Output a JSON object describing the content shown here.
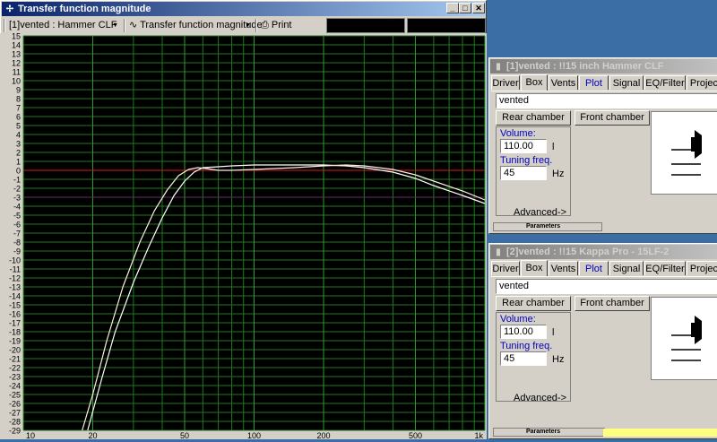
{
  "main_window": {
    "title": "Transfer function magnitude",
    "toolbar": {
      "driver_select": "[1]vented : Hammer CLF",
      "plot_select": "Transfer function magnitude",
      "print_label": "Print"
    }
  },
  "chart_data": {
    "type": "line",
    "xscale": "log",
    "xlim": [
      10,
      1000
    ],
    "ylim": [
      -29,
      15
    ],
    "x_ticks": [
      "10",
      "20",
      "50",
      "100",
      "200",
      "500",
      "1k"
    ],
    "y_ticks": [
      "15",
      "14",
      "13",
      "12",
      "11",
      "10",
      "9",
      "8",
      "7",
      "6",
      "5",
      "4",
      "3",
      "2",
      "1",
      "0",
      "-1",
      "-2",
      "-3",
      "-4",
      "-5",
      "-6",
      "-7",
      "-8",
      "-9",
      "-10",
      "-11",
      "-12",
      "-13",
      "-14",
      "-15",
      "-16",
      "-17",
      "-18",
      "-19",
      "-20",
      "-21",
      "-22",
      "-23",
      "-24",
      "-25",
      "-26",
      "-27",
      "-28",
      "-29"
    ],
    "grid": true,
    "reference_line": 0,
    "series": [
      {
        "color": "#ffffff",
        "x": [
          19,
          22,
          25,
          30,
          35,
          40,
          45,
          50,
          55,
          60,
          70,
          80,
          100,
          150,
          200,
          250,
          300,
          400,
          500,
          600,
          800,
          1000
        ],
        "y": [
          -29,
          -23,
          -18,
          -12.5,
          -8.5,
          -5.3,
          -2.8,
          -1.2,
          -0.2,
          0.3,
          0.4,
          0.5,
          0.6,
          0.6,
          0.6,
          0.5,
          0.3,
          -0.2,
          -0.9,
          -1.7,
          -2.8,
          -3.7
        ]
      },
      {
        "color": "#ffeedd",
        "x": [
          18,
          20,
          23,
          27,
          32,
          37,
          42,
          47,
          52,
          57,
          62,
          70,
          80,
          100,
          150,
          200,
          250,
          300,
          400,
          500,
          600,
          800,
          1000
        ],
        "y": [
          -29,
          -25,
          -19,
          -13,
          -8,
          -4.5,
          -2.2,
          -0.6,
          0.1,
          0.3,
          0.2,
          0.0,
          0.0,
          0.1,
          0.3,
          0.5,
          0.6,
          0.5,
          0.1,
          -0.5,
          -1.2,
          -2.3,
          -3.3
        ]
      }
    ]
  },
  "panels": [
    {
      "title": "[1]vented : !!15 inch Hammer CLF",
      "tabs": [
        "Driver",
        "Box",
        "Vents",
        "Plot",
        "Signal",
        "EQ/Filter",
        "Project"
      ],
      "selected_tab": "Box",
      "box_type": "vented",
      "rear_chamber": "Rear chamber",
      "front_chamber": "Front chamber",
      "volume_label": "Volume:",
      "volume_value": "110.00",
      "volume_unit": "l",
      "tuning_label": "Tuning freq.",
      "tuning_value": "45",
      "tuning_unit": "Hz",
      "advanced_label": "Advanced->",
      "status": "Parameters"
    },
    {
      "title": "[2]vented : !!15 Kappa Pro - 15LF-2",
      "tabs": [
        "Driver",
        "Box",
        "Vents",
        "Plot",
        "Signal",
        "EQ/Filter",
        "Project"
      ],
      "selected_tab": "Box",
      "box_type": "vented",
      "rear_chamber": "Rear chamber",
      "front_chamber": "Front chamber",
      "volume_label": "Volume:",
      "volume_value": "110.00",
      "volume_unit": "l",
      "tuning_label": "Tuning freq.",
      "tuning_value": "45",
      "tuning_unit": "Hz",
      "advanced_label": "Advanced->",
      "status": "Parameters"
    }
  ]
}
